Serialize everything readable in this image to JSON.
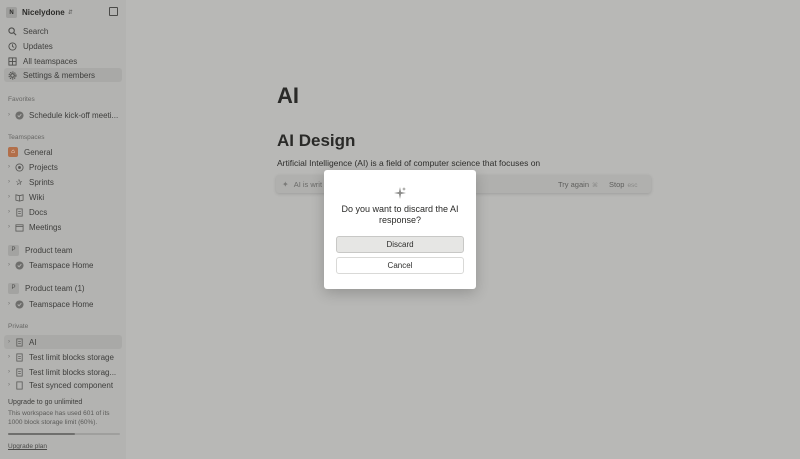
{
  "workspace": {
    "avatar": "N",
    "name": "Nicelydone"
  },
  "nav": [
    {
      "label": "Search",
      "icon": "search-icon"
    },
    {
      "label": "Updates",
      "icon": "clock-icon"
    },
    {
      "label": "All teamspaces",
      "icon": "grid-icon"
    },
    {
      "label": "Settings & members",
      "icon": "gear-icon"
    }
  ],
  "sections": {
    "favorites": "Favorites",
    "teamspaces": "Teamspaces",
    "private": "Private"
  },
  "favorites": [
    {
      "label": "Schedule kick-off meeti..."
    }
  ],
  "teamspaces": {
    "general": "General",
    "items": [
      {
        "label": "Projects"
      },
      {
        "label": "Sprints"
      },
      {
        "label": "Wiki"
      },
      {
        "label": "Docs"
      },
      {
        "label": "Meetings"
      }
    ],
    "product_team": {
      "badge": "P",
      "label": "Product team",
      "child": "Teamspace Home"
    },
    "product_team_1": {
      "badge": "P",
      "label": "Product team (1)",
      "child": "Teamspace Home"
    }
  },
  "private": [
    {
      "label": "AI"
    },
    {
      "label": "Test limit blocks storage"
    },
    {
      "label": "Test limit blocks storag..."
    },
    {
      "label": "Test synced component"
    }
  ],
  "upgrade": {
    "title": "Upgrade to go unlimited",
    "description": "This workspace has used 601 of its 1000 block storage limit (60%).",
    "usage_fraction": 0.6,
    "link": "Upgrade plan"
  },
  "page": {
    "title": "AI",
    "heading": "AI Design",
    "paragraph": "Artificial Intelligence (AI) is a field of computer science that focuses on",
    "ai_bar": {
      "status": "AI is writ",
      "try_again": "Try again",
      "try_again_key": "⌘",
      "stop": "Stop",
      "stop_key": "esc"
    }
  },
  "modal": {
    "question": "Do you want to discard the AI response?",
    "discard": "Discard",
    "cancel": "Cancel"
  }
}
